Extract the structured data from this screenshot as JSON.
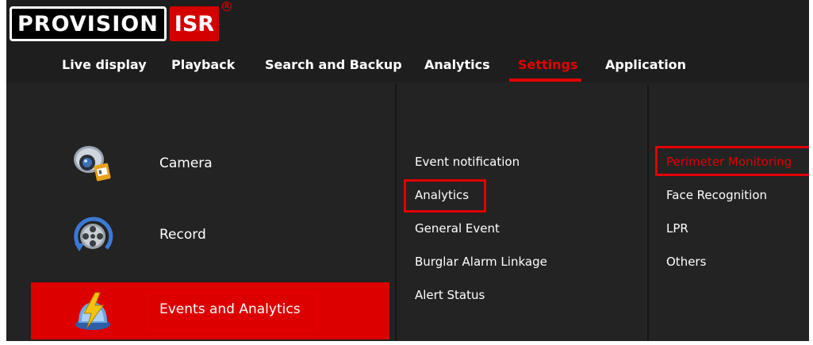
{
  "brand": {
    "logo_main": "PROVISION",
    "logo_suffix": "ISR",
    "registered_mark": "R"
  },
  "nav": {
    "items": [
      {
        "label": "Live display"
      },
      {
        "label": "Playback"
      },
      {
        "label": "Search and Backup"
      },
      {
        "label": "Analytics"
      },
      {
        "label": "Settings",
        "active": true
      },
      {
        "label": "Application"
      }
    ]
  },
  "left_menu": {
    "items": [
      {
        "label": "Camera",
        "icon": "camera-icon"
      },
      {
        "label": "Record",
        "icon": "record-reel-icon"
      },
      {
        "label": "Events and Analytics",
        "icon": "lightning-alarm-icon",
        "selected": true
      }
    ]
  },
  "middle_menu": {
    "items": [
      {
        "label": "Event notification"
      },
      {
        "label": "Analytics",
        "highlighted": true
      },
      {
        "label": "General Event"
      },
      {
        "label": "Burglar Alarm Linkage"
      },
      {
        "label": "Alert Status"
      }
    ]
  },
  "right_menu": {
    "items": [
      {
        "label": "Perimeter Monitoring",
        "active": true,
        "highlighted": true
      },
      {
        "label": "Face Recognition"
      },
      {
        "label": "LPR"
      },
      {
        "label": "Others"
      }
    ]
  },
  "colors": {
    "accent": "#e30000",
    "background": "#232323",
    "selected_bg": "#dd0000",
    "text": "#ffffff"
  }
}
